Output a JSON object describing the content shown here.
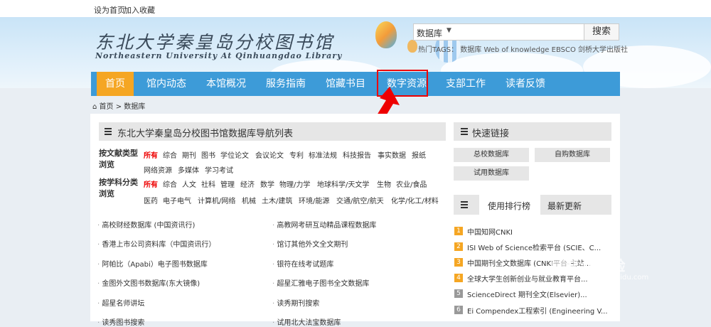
{
  "topbar": {
    "set_home": "设为首页",
    "add_favorite": "加入收藏"
  },
  "header": {
    "logo_cn": "东北大学秦皇岛分校图书馆",
    "logo_en": "Northeastern University At Qinhuangdao Library",
    "search": {
      "scope": "数据库",
      "button": "搜索",
      "value": ""
    },
    "hot_tags": "热门TAGS： 数据库 Web of knowledge EBSCO 剑桥大学出版社"
  },
  "nav": {
    "items": [
      "首页",
      "馆内动态",
      "本馆概况",
      "服务指南",
      "馆藏书目",
      "数字资源",
      "支部工作",
      "读者反馈"
    ]
  },
  "breadcrumb": "首页 > 数据库",
  "db_panel": {
    "title": "东北大学秦皇岛分校图书馆数据库导航列表",
    "doc_type_label": "按文献类型浏览",
    "doc_type_row1": [
      "所有",
      "综合",
      "期刊",
      "图书",
      "学位论文",
      "会议论文",
      "专利",
      "标准法规",
      "科技报告",
      "事实数据",
      "报纸"
    ],
    "doc_type_row2": [
      "网络资源",
      "多媒体",
      "学习考试"
    ],
    "subject_label": "按学科分类浏览",
    "subject_row1": [
      "所有",
      "综合",
      "人文",
      "社科",
      "管理",
      "经济",
      "数学",
      "物理/力学",
      "地球科学/天文学",
      "生物",
      "农业/食品"
    ],
    "subject_row2": [
      "医药",
      "电子电气",
      "计算机/网络",
      "机械",
      "土木/建筑",
      "环境/能源",
      "交通/航空/航天",
      "化学/化工/材料"
    ],
    "databases": [
      [
        "高校财经数据库 (中国资讯行)",
        "高教网考研互动精品课程数据库"
      ],
      [
        "香港上市公司资料库（中国资讯行）",
        "馆订其他外文全文期刊"
      ],
      [
        "阿帕比（Apabi）电子图书数据库",
        "银符在线考试题库"
      ],
      [
        "金图外文图书数据库(东大镜像)",
        "超星汇雅电子图书全文数据库"
      ],
      [
        "超星名师讲坛",
        "读秀期刊搜索"
      ],
      [
        "读秀图书搜索",
        "试用北大法宝数据库"
      ]
    ]
  },
  "quick": {
    "title": "快速链接",
    "buttons": [
      "总校数据库",
      "自购数据库",
      "试用数据库"
    ]
  },
  "ranking": {
    "tab_active": "使用排行榜",
    "tab_other": "最新更新",
    "items": [
      {
        "num": "1",
        "text": "中国知网CNKI"
      },
      {
        "num": "2",
        "text": "ISI Web of Science检索平台 (SCIE、C..."
      },
      {
        "num": "3",
        "text": "中国期刊全文数据库 (CNKI平台-主站..."
      },
      {
        "num": "4",
        "text": "全球大学生创新创业与就业教育平台..."
      },
      {
        "num": "5",
        "text": "ScienceDirect 期刊全文(Elsevier)..."
      },
      {
        "num": "6",
        "text": "Ei Compendex工程索引 (Engineering V..."
      }
    ],
    "colors": {
      "top": "#f5a623",
      "rest": "#999999"
    }
  },
  "watermark": {
    "brand": "Bai 经验",
    "url": "jingyan.baidu.com"
  },
  "colors": {
    "nav": "#3d9bd8",
    "nav_active": "#f5a623",
    "highlight": "#ee0000"
  }
}
